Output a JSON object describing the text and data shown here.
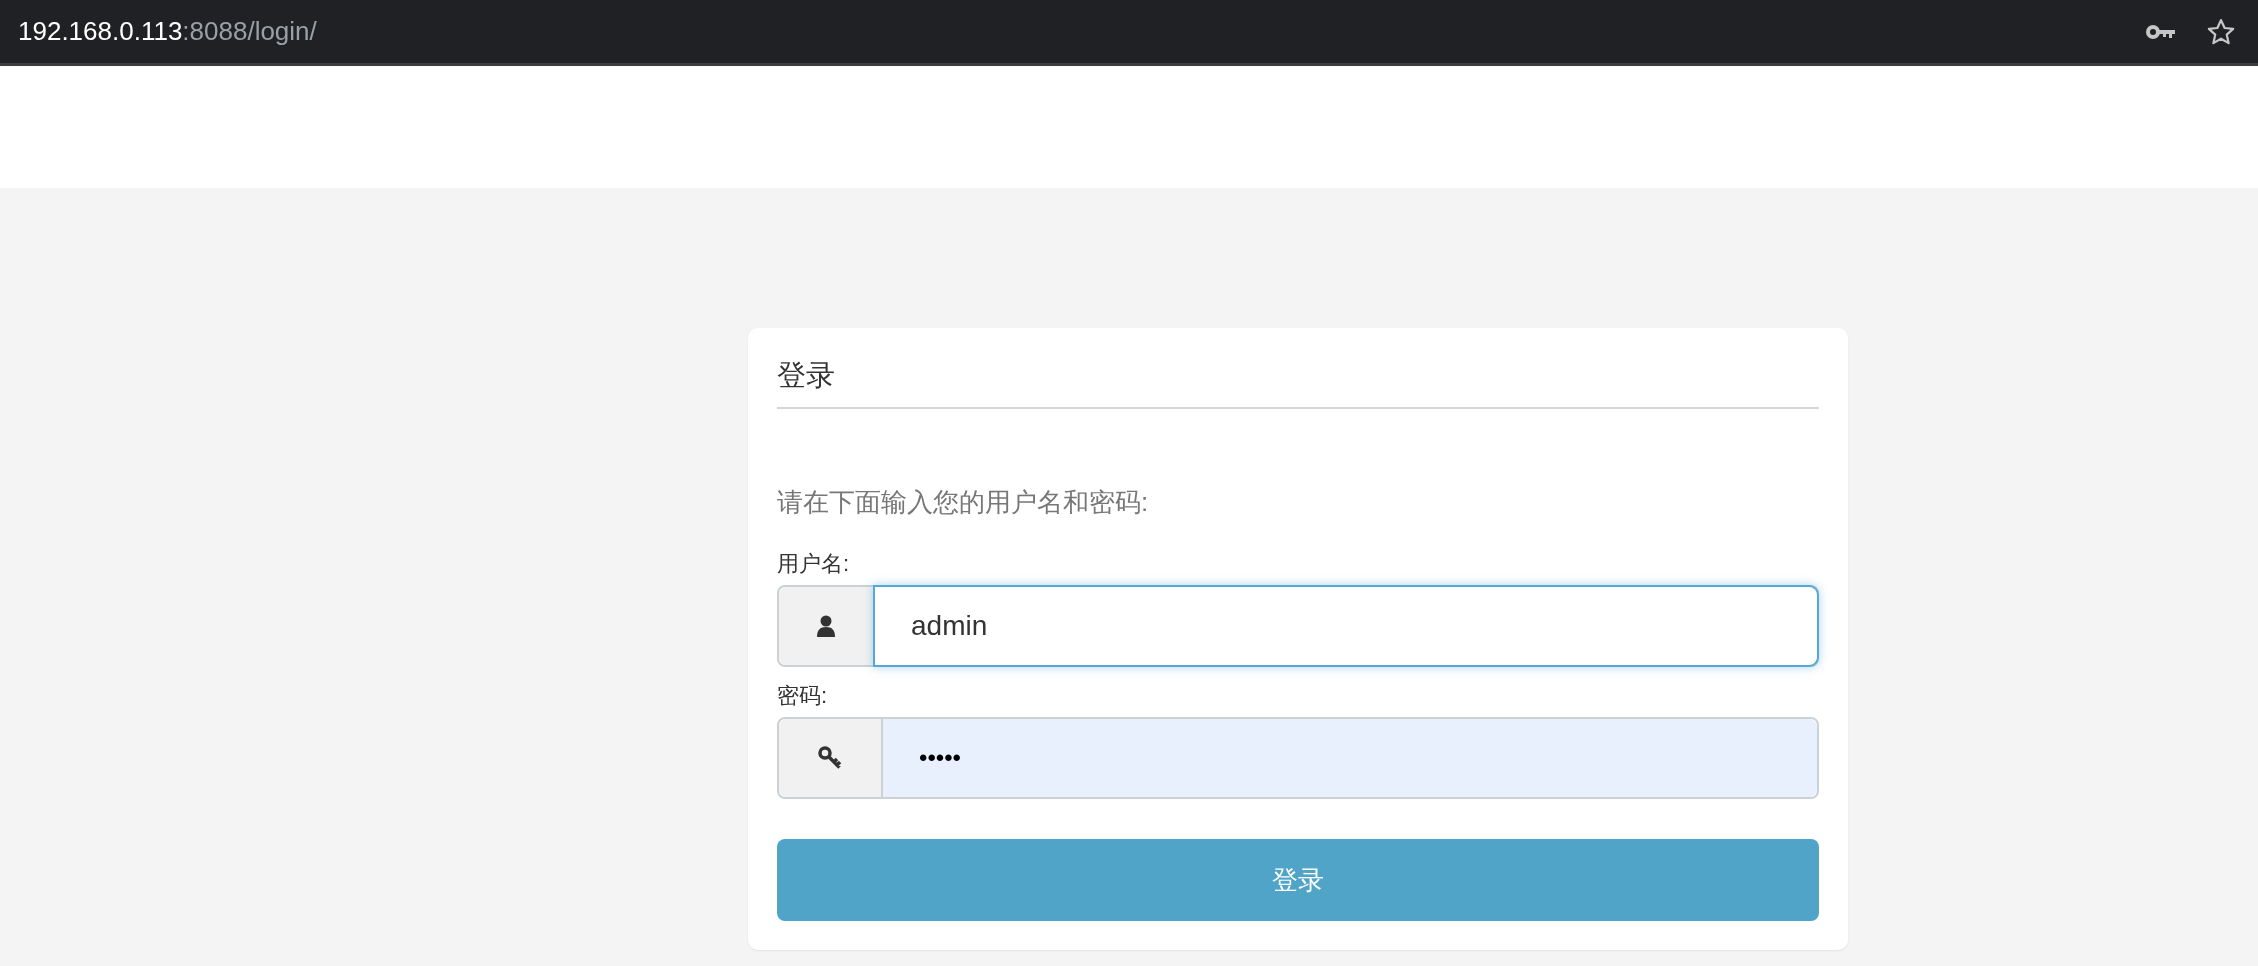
{
  "address_bar": {
    "host": "192.168.0.113",
    "path": ":8088/login/"
  },
  "login": {
    "title": "登录",
    "prompt": "请在下面输入您的用户名和密码:",
    "fields": [
      {
        "kind": "user",
        "label": "用户名:",
        "value": "admin",
        "focused": true,
        "autofilled": false
      },
      {
        "kind": "password",
        "label": "密码:",
        "value": "•••••",
        "focused": false,
        "autofilled": true
      }
    ],
    "submit": "登录"
  }
}
